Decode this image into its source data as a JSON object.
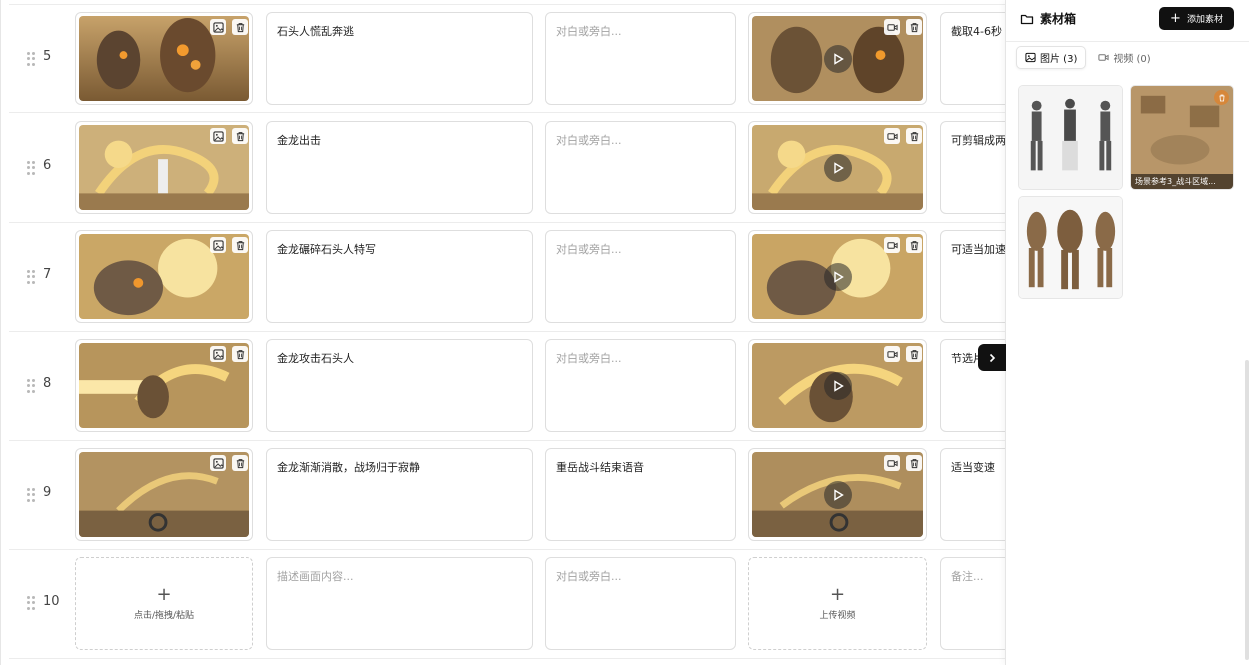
{
  "rows": [
    {
      "number": "5",
      "description": "石头人慌乱奔逃",
      "dialogue": "对白或旁白...",
      "dialogue_filled": false,
      "note": "截取4-6秒"
    },
    {
      "number": "6",
      "description": "金龙出击",
      "dialogue": "对白或旁白...",
      "dialogue_filled": false,
      "note": "可剪辑成两个"
    },
    {
      "number": "7",
      "description": "金龙碾碎石头人特写",
      "dialogue": "对白或旁白...",
      "dialogue_filled": false,
      "note": "可适当加速"
    },
    {
      "number": "8",
      "description": "金龙攻击石头人",
      "dialogue": "对白或旁白...",
      "dialogue_filled": false,
      "note": "节选片"
    },
    {
      "number": "9",
      "description": "金龙渐渐消散，战场归于寂静",
      "dialogue": "重岳战斗结束语音",
      "dialogue_filled": true,
      "note": "适当变速"
    }
  ],
  "new_row": {
    "number": "10",
    "image_upload_label": "点击/拖拽/粘贴",
    "description_placeholder": "描述画面内容...",
    "dialogue_placeholder": "对白或旁白...",
    "video_upload_label": "上传视频",
    "note_placeholder": "备注..."
  },
  "panel": {
    "title": "素材箱",
    "add_button": "添加素材",
    "tabs": [
      {
        "label": "图片 (3)",
        "active": true,
        "icon": "image-icon"
      },
      {
        "label": "视频 (0)",
        "active": false,
        "icon": "video-icon"
      }
    ],
    "assets": [
      {
        "caption": "",
        "kind": "character-turnaround"
      },
      {
        "caption": "场景参考3_战斗区域...",
        "kind": "scene"
      },
      {
        "caption": "",
        "kind": "stone-golem-turnaround"
      }
    ]
  },
  "colors": {
    "accent": "#111111",
    "gold": "#d9a441",
    "border": "#dedede",
    "placeholder": "#a3a3a3"
  }
}
